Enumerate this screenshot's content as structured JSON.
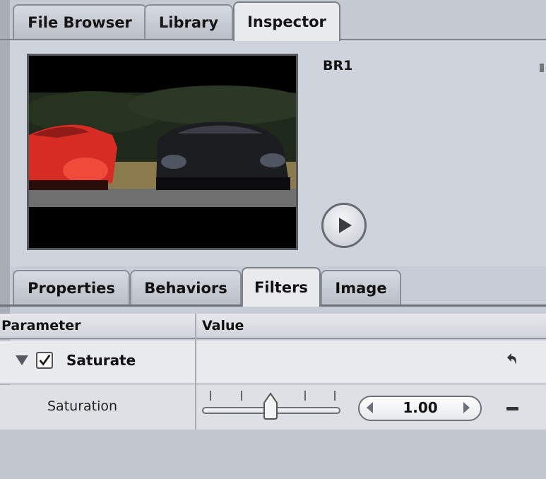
{
  "top_tabs": [
    {
      "label": "File Browser"
    },
    {
      "label": "Library"
    },
    {
      "label": "Inspector"
    }
  ],
  "active_top_tab": "Inspector",
  "clip": {
    "name": "BR1"
  },
  "sub_tabs": [
    {
      "label": "Properties"
    },
    {
      "label": "Behaviors"
    },
    {
      "label": "Filters"
    },
    {
      "label": "Image"
    }
  ],
  "active_sub_tab": "Filters",
  "table": {
    "headers": {
      "parameter": "Parameter",
      "value": "Value"
    },
    "filter": {
      "name": "Saturate",
      "enabled": true,
      "expanded": true
    },
    "params": [
      {
        "label": "Saturation",
        "value": "1.00"
      }
    ]
  },
  "icons": {
    "play": "play-icon",
    "reset": "reset-arrow-icon",
    "stepper_left": "chevron-left-icon",
    "stepper_right": "chevron-right-icon",
    "remove": "minus-icon"
  },
  "colors": {
    "panel": "#c7ccd6",
    "active_tab": "#e8eaee"
  }
}
